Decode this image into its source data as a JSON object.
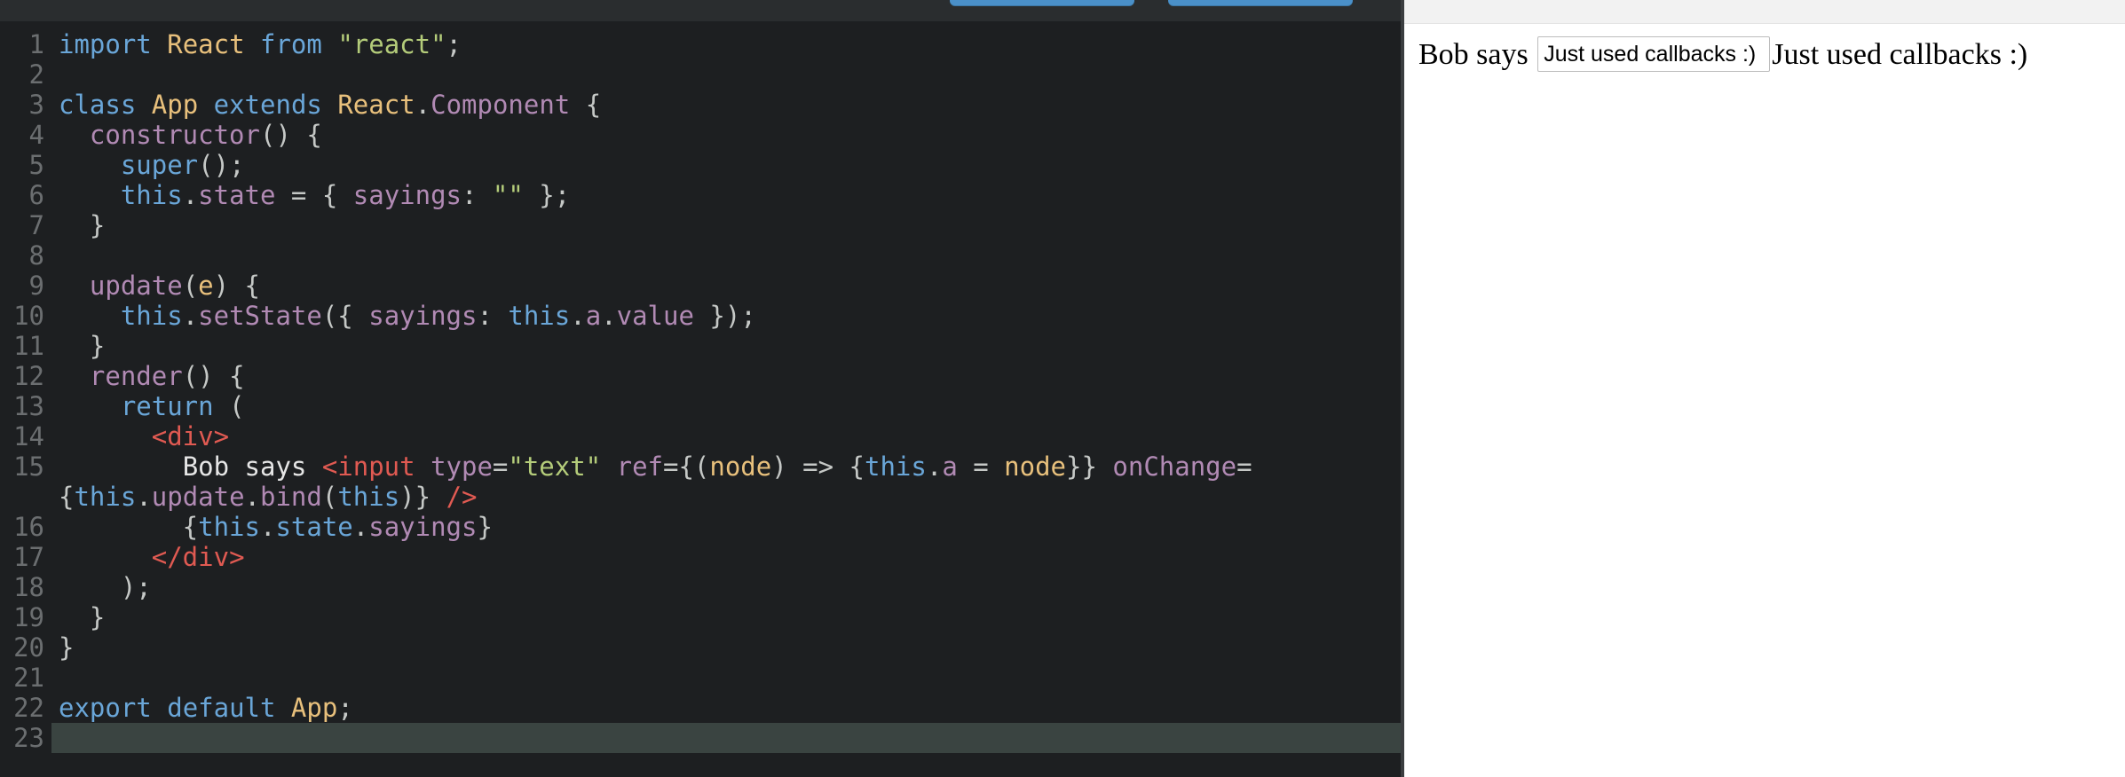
{
  "editor": {
    "active_line": 23,
    "lines": [
      {
        "n": "1",
        "tokens": [
          {
            "t": "import",
            "c": "kw"
          },
          {
            "t": " "
          },
          {
            "t": "React",
            "c": "cls"
          },
          {
            "t": " "
          },
          {
            "t": "from",
            "c": "kw"
          },
          {
            "t": " "
          },
          {
            "t": "\"react\"",
            "c": "str"
          },
          {
            "t": ";"
          }
        ]
      },
      {
        "n": "2",
        "tokens": []
      },
      {
        "n": "3",
        "tokens": [
          {
            "t": "class",
            "c": "kw"
          },
          {
            "t": " "
          },
          {
            "t": "App",
            "c": "cls"
          },
          {
            "t": " "
          },
          {
            "t": "extends",
            "c": "kw"
          },
          {
            "t": " "
          },
          {
            "t": "React",
            "c": "cls"
          },
          {
            "t": "."
          },
          {
            "t": "Component",
            "c": "pr"
          },
          {
            "t": " {"
          }
        ]
      },
      {
        "n": "4",
        "tokens": [
          {
            "t": "  "
          },
          {
            "t": "constructor",
            "c": "pr"
          },
          {
            "t": "() {"
          }
        ]
      },
      {
        "n": "5",
        "tokens": [
          {
            "t": "    "
          },
          {
            "t": "super",
            "c": "kw"
          },
          {
            "t": "();"
          }
        ]
      },
      {
        "n": "6",
        "tokens": [
          {
            "t": "    "
          },
          {
            "t": "this",
            "c": "kw"
          },
          {
            "t": "."
          },
          {
            "t": "state",
            "c": "pr"
          },
          {
            "t": " = { "
          },
          {
            "t": "sayings",
            "c": "pr"
          },
          {
            "t": ": "
          },
          {
            "t": "\"\"",
            "c": "str"
          },
          {
            "t": " };"
          }
        ]
      },
      {
        "n": "7",
        "tokens": [
          {
            "t": "  }"
          }
        ]
      },
      {
        "n": "8",
        "tokens": []
      },
      {
        "n": "9",
        "tokens": [
          {
            "t": "  "
          },
          {
            "t": "update",
            "c": "pr"
          },
          {
            "t": "("
          },
          {
            "t": "e",
            "c": "par"
          },
          {
            "t": ") {"
          }
        ]
      },
      {
        "n": "10",
        "tokens": [
          {
            "t": "    "
          },
          {
            "t": "this",
            "c": "kw"
          },
          {
            "t": "."
          },
          {
            "t": "setState",
            "c": "pr"
          },
          {
            "t": "({ "
          },
          {
            "t": "sayings",
            "c": "pr"
          },
          {
            "t": ": "
          },
          {
            "t": "this",
            "c": "kw"
          },
          {
            "t": "."
          },
          {
            "t": "a",
            "c": "pr"
          },
          {
            "t": "."
          },
          {
            "t": "value",
            "c": "pr"
          },
          {
            "t": " });"
          }
        ]
      },
      {
        "n": "11",
        "tokens": [
          {
            "t": "  }"
          }
        ]
      },
      {
        "n": "12",
        "tokens": [
          {
            "t": "  "
          },
          {
            "t": "render",
            "c": "pr"
          },
          {
            "t": "() {"
          }
        ]
      },
      {
        "n": "13",
        "tokens": [
          {
            "t": "    "
          },
          {
            "t": "return",
            "c": "kw"
          },
          {
            "t": " ("
          }
        ]
      },
      {
        "n": "14",
        "tokens": [
          {
            "t": "      "
          },
          {
            "t": "<div>",
            "c": "tg"
          }
        ]
      },
      {
        "n": "15",
        "tall": true,
        "tokens": [
          {
            "t": "        "
          },
          {
            "t": "Bob says ",
            "c": "tx"
          },
          {
            "t": "<input",
            "c": "tg"
          },
          {
            "t": " "
          },
          {
            "t": "type",
            "c": "pr"
          },
          {
            "t": "="
          },
          {
            "t": "\"text\"",
            "c": "str"
          },
          {
            "t": " "
          },
          {
            "t": "ref",
            "c": "pr"
          },
          {
            "t": "={("
          },
          {
            "t": "node",
            "c": "par"
          },
          {
            "t": ") => {"
          },
          {
            "t": "this",
            "c": "kw"
          },
          {
            "t": "."
          },
          {
            "t": "a",
            "c": "pr"
          },
          {
            "t": " = "
          },
          {
            "t": "node",
            "c": "par"
          },
          {
            "t": "}} "
          },
          {
            "t": "onChange",
            "c": "pr"
          },
          {
            "t": "=\n{"
          },
          {
            "t": "this",
            "c": "kw"
          },
          {
            "t": "."
          },
          {
            "t": "update",
            "c": "pr"
          },
          {
            "t": "."
          },
          {
            "t": "bind",
            "c": "pr"
          },
          {
            "t": "("
          },
          {
            "t": "this",
            "c": "kw"
          },
          {
            "t": ")} "
          },
          {
            "t": "/>",
            "c": "tg"
          }
        ]
      },
      {
        "n": "16",
        "tokens": [
          {
            "t": "        {"
          },
          {
            "t": "this",
            "c": "kw"
          },
          {
            "t": "."
          },
          {
            "t": "state",
            "c": "kw"
          },
          {
            "t": "."
          },
          {
            "t": "sayings",
            "c": "pr"
          },
          {
            "t": "}"
          }
        ]
      },
      {
        "n": "17",
        "tokens": [
          {
            "t": "      "
          },
          {
            "t": "</div>",
            "c": "tg"
          }
        ]
      },
      {
        "n": "18",
        "tokens": [
          {
            "t": "    );"
          }
        ]
      },
      {
        "n": "19",
        "tokens": [
          {
            "t": "  }"
          }
        ]
      },
      {
        "n": "20",
        "tokens": [
          {
            "t": "}"
          }
        ]
      },
      {
        "n": "21",
        "tokens": []
      },
      {
        "n": "22",
        "tokens": [
          {
            "t": "export",
            "c": "kw"
          },
          {
            "t": " "
          },
          {
            "t": "default",
            "c": "kw"
          },
          {
            "t": " "
          },
          {
            "t": "App",
            "c": "cls"
          },
          {
            "t": ";"
          }
        ]
      },
      {
        "n": "23",
        "tokens": []
      }
    ]
  },
  "preview": {
    "prefix": "Bob says ",
    "input_value": "Just used callbacks :)",
    "sayings": "Just used callbacks :)"
  }
}
